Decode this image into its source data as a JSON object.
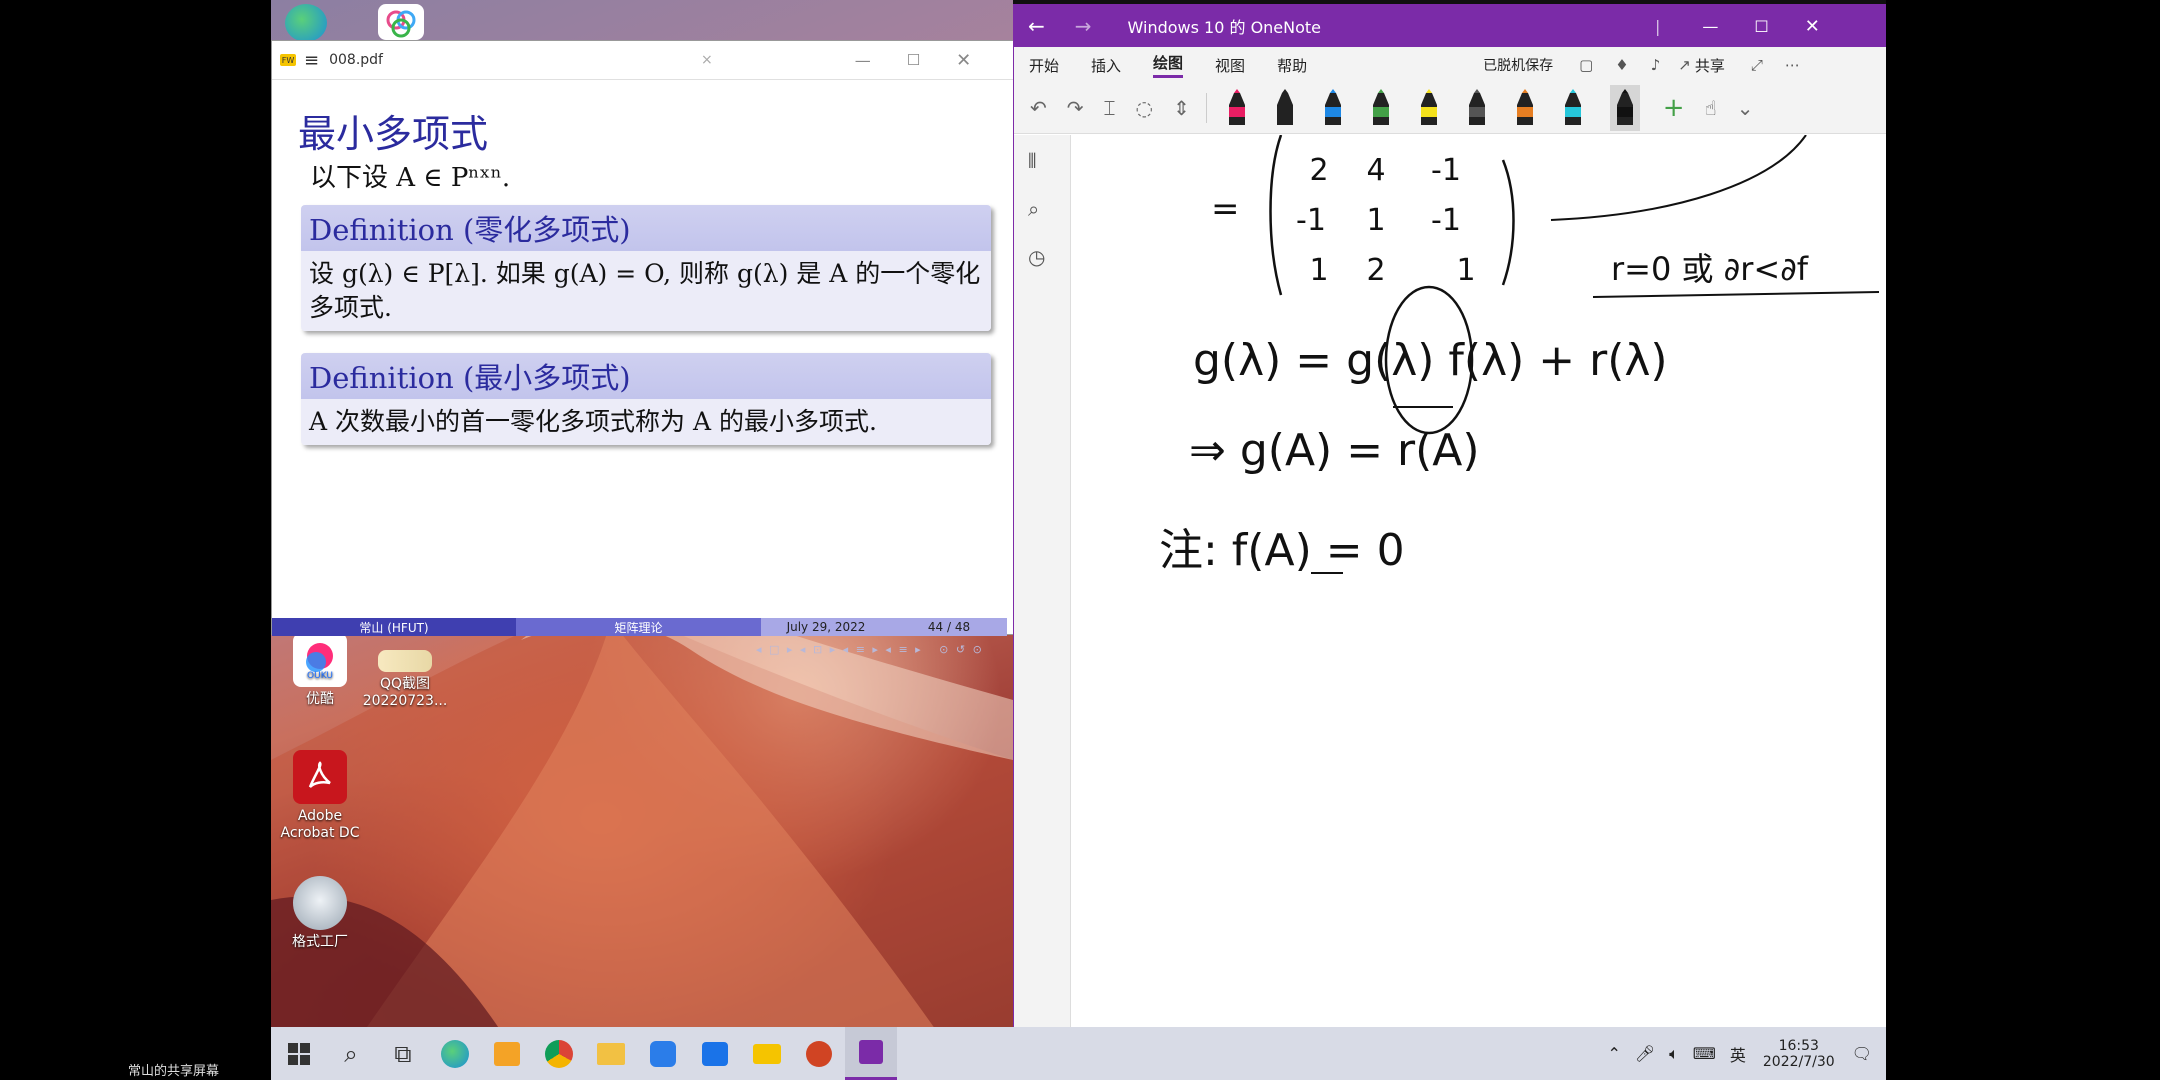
{
  "share_label": "常山的共享屏幕",
  "pdf": {
    "title": "008.pdf",
    "slide_title": "最小多项式",
    "intro": "以下设 A ∈ Pⁿˣⁿ.",
    "blocks": [
      {
        "title": "Definition (零化多项式)",
        "body": "设 g(λ) ∈ P[λ]. 如果 g(A) = O, 则称 g(λ) 是 A 的一个零化多项式."
      },
      {
        "title": "Definition (最小多项式)",
        "body": "A 次数最小的首一零化多项式称为 A 的最小多项式."
      }
    ],
    "footer": {
      "author": "常山 (HFUT)",
      "subject": "矩阵理论",
      "date": "July 29, 2022",
      "page": "44 / 48"
    }
  },
  "desktop_icons": [
    {
      "label": "优酷"
    },
    {
      "label": "QQ截图\n20220723..."
    },
    {
      "label": "Adobe\nAcrobat DC"
    },
    {
      "label": "格式工厂"
    }
  ],
  "onenote": {
    "title": "Windows 10 的 OneNote",
    "menu": [
      "开始",
      "插入",
      "绘图",
      "视图",
      "帮助"
    ],
    "active_menu": "绘图",
    "saved": "已脱机保存",
    "share": "共享",
    "ink": {
      "line1": "g(λ) = g(λ) f(λ) + r(λ)",
      "line2": "⇒ g(A) = r(A)",
      "line3": "注: f(A) = 0",
      "note": "r=0 或 ∂r<∂f",
      "matrix": [
        [
          "2",
          "4",
          "-1"
        ],
        [
          "-1",
          "1",
          "-1"
        ],
        [
          "1",
          "2",
          "1"
        ]
      ]
    },
    "pen_colors": [
      "#e91e63",
      "#222222",
      "#1e88e5",
      "#43a047",
      "#f4e11c",
      "#555555",
      "#e67e22",
      "#26c6da",
      "#111111"
    ]
  },
  "taskbar": {
    "time": "16:53",
    "date": "2022/7/30",
    "ime": "英"
  }
}
